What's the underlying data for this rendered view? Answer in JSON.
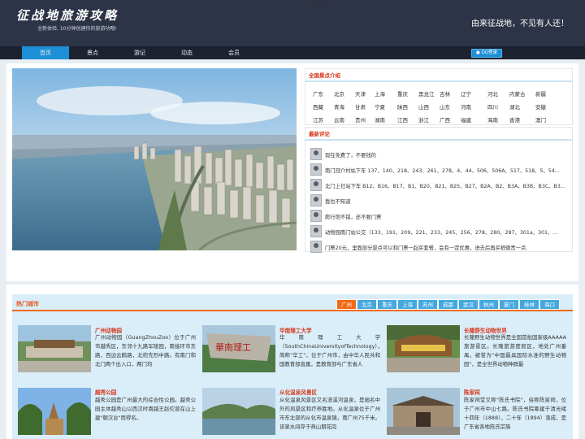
{
  "header": {
    "logo_title": "征战地旅游攻略",
    "logo_sub": "全新体验, 10分钟创建你的旅游功略!",
    "slogan": "由来征战地，不见有人还！"
  },
  "nav": {
    "items": [
      {
        "label": "首页",
        "active": true
      },
      {
        "label": "景点",
        "active": false
      },
      {
        "label": "游记",
        "active": false
      },
      {
        "label": "动态",
        "active": false
      },
      {
        "label": "会员",
        "active": false
      }
    ],
    "qq_login": "QQ登录"
  },
  "provinces": {
    "title": "全国景点介绍",
    "items": [
      "广东",
      "北京",
      "天津",
      "上海",
      "重庆",
      "黑龙江",
      "吉林",
      "辽宁",
      "河北",
      "内蒙古",
      "新疆",
      "西藏",
      "青海",
      "甘肃",
      "宁夏",
      "陕西",
      "山西",
      "山东",
      "河南",
      "四川",
      "湖北",
      "安徽",
      "江苏",
      "云南",
      "贵州",
      "湖南",
      "江西",
      "浙江",
      "广西",
      "福建",
      "海南",
      "香港",
      "澳门",
      "台湾"
    ]
  },
  "comments": {
    "title": "最新评论",
    "items": [
      "现在免费了，不要钱的",
      "南门冠介村站下车 137、140、218、243、261、278、4、44、506、506A、517、518、5、54...",
      "北门上社站下车 B12、B16、B17、B1、B20、B21、B25、B27、B2A、B2、B3A、B3B、B3C、B3...",
      "我也不知道",
      "爬行馆不错，还不要门票",
      "动物园南门站公交（133、191、209、221、233、245、256、278、280、287、301a、301、...",
      "门票20元，里面部分景点可以和门票一起买套餐，会有一定优惠，进去后再买稍微贵一点."
    ]
  },
  "hot": {
    "title": "热门城市",
    "tabs": [
      "广州",
      "北京",
      "重庆",
      "上海",
      "苏州",
      "成都",
      "武汉",
      "杭州",
      "厦门",
      "桂林",
      "海口"
    ],
    "active_tab": "广州",
    "cards": [
      {
        "title": "广州动物园",
        "text": "广州动物园（GuangZhouZoo）位于广州市越秀区，东邻十九路军陵园，南接环市东路，西边云鹤路，北衔先烈中路。有南门和北门两个出入口，两门均"
      },
      {
        "title": "华南理工大学",
        "text": "华南理工大学（SouthChinaUniversityofTechnology），简称\"华工\"，位于广州市，由中华人民共和国教育部直属，是教育部与广东省人"
      },
      {
        "title": "长隆野生动物世界",
        "text": "长隆野生动物世界是全国首批国家级AAAAA旅游景区。长隆旅游度假区，地处广州番禺。被誉为\"中国最具国际水准的野生动物园\"，是全世界动物种群最"
      },
      {
        "title": "越秀公园",
        "text": "越秀公园是广州最大的综合性公园。越秀公园主体越秀山以西汉时南越王赵佗曾在山上建\"朝汉台\"而得名。"
      },
      {
        "title": "从化温泉风景区",
        "text": "从化温泉风景区又名流溪河温泉，是驰名中外的风景区和疗养胜地。从化温泉位于广州市东北部的从化市温泉镇，南广州75千米。该泉水间存于燕山期花岗"
      },
      {
        "title": "陈家祠",
        "text": "陈家祠堂又称\"陈氏书院\"，俗称陈家祠，位于广州市中山七路。陈氏书院筹建于清光绪十四年（1888），二十年（1894）落成，是广东省各地陈氏宗族"
      }
    ]
  }
}
